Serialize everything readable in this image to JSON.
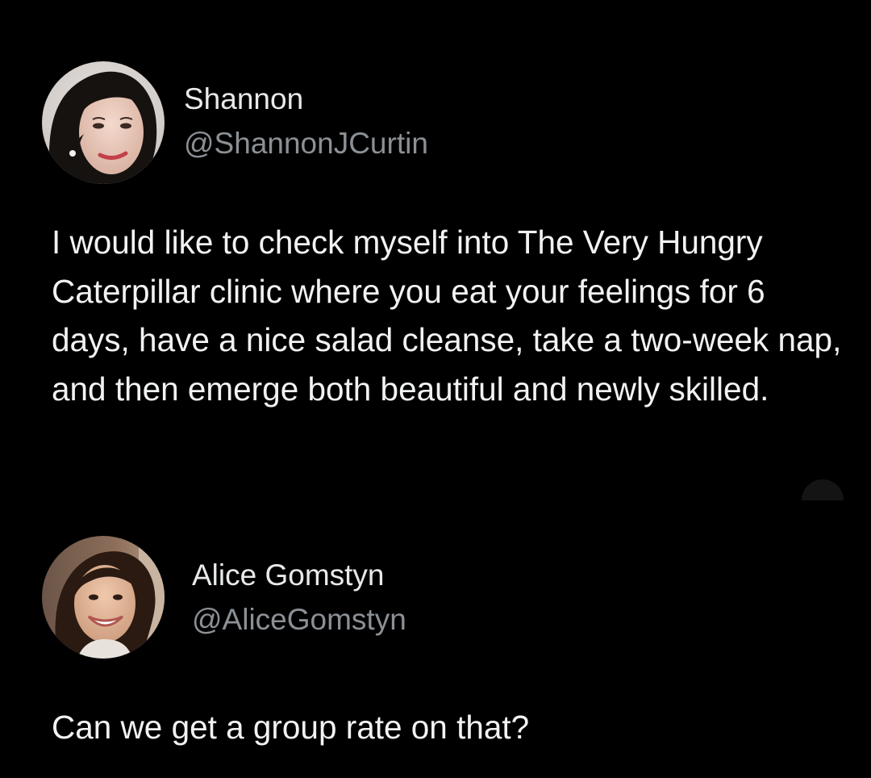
{
  "colors": {
    "background": "#000000",
    "name": "#e7e9ea",
    "handle": "#8b9095",
    "body": "#f1f2f3"
  },
  "tweets": [
    {
      "display_name": "Shannon",
      "handle": "@ShannonJCurtin",
      "avatar_icon": "profile-photo-woman-dark-hair",
      "text": "I would like to check myself into The Very Hungry Caterpillar clinic where you eat your feelings for 6 days, have a nice salad cleanse, take a two-week nap, and then emerge both beautiful and newly skilled."
    },
    {
      "display_name": "Alice Gomstyn",
      "handle": "@AliceGomstyn",
      "avatar_icon": "profile-photo-woman-smiling",
      "text": "Can we get a group rate on that?"
    }
  ]
}
